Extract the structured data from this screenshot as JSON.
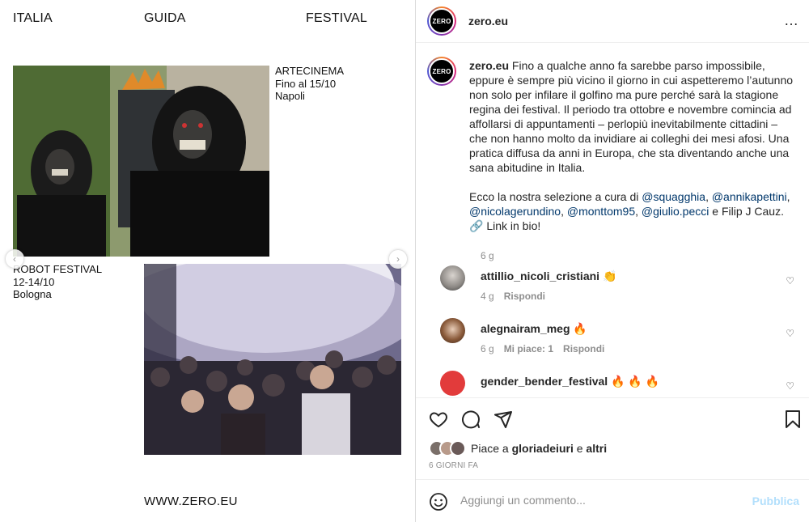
{
  "post_image": {
    "nav": [
      "ITALIA",
      "GUIDA",
      "FESTIVAL"
    ],
    "caption_arte": [
      "ARTECINEMA",
      "Fino al 15/10",
      "Napoli"
    ],
    "caption_robot": [
      "ROBOT FESTIVAL",
      "12-14/10",
      "Bologna"
    ],
    "footer": "WWW.ZERO.EU",
    "arrow_left": "‹",
    "arrow_right": "›"
  },
  "header": {
    "avatar_text": "ZERO",
    "username": "zero.eu",
    "more_icon": "…"
  },
  "caption": {
    "username": "zero.eu",
    "text_1": "Fino a qualche anno fa sarebbe parso impossibile, eppure è sempre più vicino il giorno in cui aspetteremo l’autunno non solo per infilare il golfino ma pure perché sarà la stagione regina dei festival. Il periodo tra ottobre e novembre comincia ad affollarsi di appuntamenti – perlopiù inevitabilmente cittadini – che non hanno molto da invidiare ai colleghi dei mesi afosi. Una pratica diffusa da anni in Europa, che sta diventando anche una sana abitudine in Italia.",
    "text_2_prefix": "Ecco la nostra selezione a cura di ",
    "mentions": [
      "@squagghia",
      "@annikapettini",
      "@nicolagerundino",
      "@monttom95",
      "@giulio.pecci"
    ],
    "text_2_suffix": " e Filip J Cauz.",
    "link_text": "🔗 Link in bio!",
    "time": "6 g"
  },
  "comments": [
    {
      "user": "attillio_nicoli_cristiani",
      "text": "👏",
      "time": "4 g",
      "likes": "",
      "reply": "Rispondi"
    },
    {
      "user": "alegnairam_meg",
      "text": "🔥",
      "time": "6 g",
      "likes": "Mi piace: 1",
      "reply": "Rispondi"
    },
    {
      "user": "gender_bender_festival",
      "text": "🔥 🔥 🔥",
      "time": "",
      "likes": "",
      "reply": ""
    }
  ],
  "likes": {
    "prefix": "Piace a ",
    "user": "gloriadeiuri",
    "middle": " e ",
    "others": "altri",
    "days": "6 GIORNI FA"
  },
  "add_comment": {
    "placeholder": "Aggiungi un commento...",
    "publish": "Pubblica"
  },
  "colors": {
    "mention": "#00376b",
    "muted": "#8e8e8e",
    "publish_disabled": "#b2dffc"
  }
}
